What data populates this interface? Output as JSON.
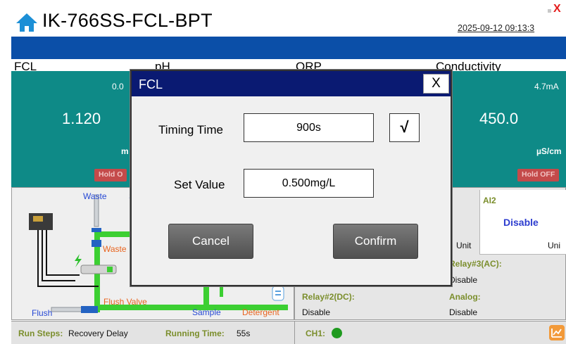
{
  "header": {
    "title": "IK-766SS-FCL-BPT",
    "datetime": "2025-09-12 09:13:3",
    "close_glyph": "X"
  },
  "channels": {
    "fcl": {
      "name": "FCL",
      "value": "1.120",
      "current": "0.0",
      "unit": "m",
      "hold": "Hold O"
    },
    "ph": {
      "name": "pH"
    },
    "orp": {
      "name": "ORP"
    },
    "conductivity": {
      "name": "Conductivity",
      "value": "450.0",
      "current": "4.7mA",
      "unit": "µS/cm",
      "hold": "Hold OFF"
    }
  },
  "process": {
    "waste_top": "Waste",
    "waste_side": "Waste",
    "flush_valve": "Flush Valve",
    "flush": "Flush",
    "sample": "Sample",
    "detergent": "Detergent",
    "top_partial": "S"
  },
  "info": {
    "ai2_label": "AI2",
    "ai2_value": "Disable",
    "ai2_unit": "Uni",
    "unit_mid": "Unit",
    "relay3_label": "Relay#3(AC):",
    "relay3_value": "Disable",
    "relay2_label": "Relay#2(DC):",
    "relay2_value": "Disable",
    "analog_label": "Analog:",
    "analog_value": "Disable"
  },
  "bottom": {
    "run_steps_label": "Run Steps:",
    "run_steps_value": "Recovery Delay",
    "running_time_label": "Running Time:",
    "running_time_value": "55s",
    "ch1_label": "CH1:"
  },
  "dialog": {
    "title": "FCL",
    "close": "X",
    "timing_label": "Timing Time",
    "timing_value": "900s",
    "check_glyph": "√",
    "set_label": "Set Value",
    "set_value": "0.500mg/L",
    "cancel": "Cancel",
    "confirm": "Confirm"
  },
  "colors": {
    "teal": "#0e8a87",
    "bluebar": "#0b4fa8",
    "dialog_title": "#0a1a72",
    "hold": "#c44a4a",
    "pipe_green": "#3ccf32",
    "olive": "#7b8e2c"
  }
}
